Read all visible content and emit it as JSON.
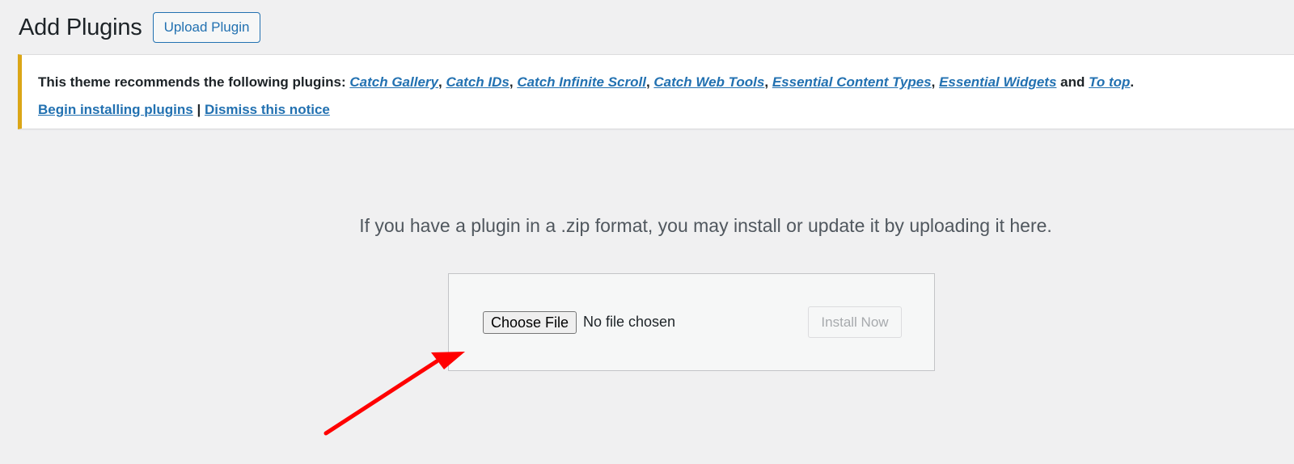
{
  "header": {
    "title": "Add Plugins",
    "upload_button": "Upload Plugin"
  },
  "notice": {
    "intro": "This theme recommends the following plugins: ",
    "plugins": [
      "Catch Gallery",
      "Catch IDs",
      "Catch Infinite Scroll",
      "Catch Web Tools",
      "Essential Content Types",
      "Essential Widgets",
      "To top"
    ],
    "separator": ", ",
    "conjunction": " and ",
    "end": ".",
    "begin_link": "Begin installing plugins",
    "pipe": " | ",
    "dismiss_link": "Dismiss this notice",
    "accent_color": "#dba617"
  },
  "upload": {
    "description": "If you have a plugin in a .zip format, you may install or update it by uploading it here.",
    "choose_file": "Choose File",
    "file_status": "No file chosen",
    "install_button": "Install Now"
  },
  "annotation": {
    "arrow_color": "#ff0000"
  }
}
